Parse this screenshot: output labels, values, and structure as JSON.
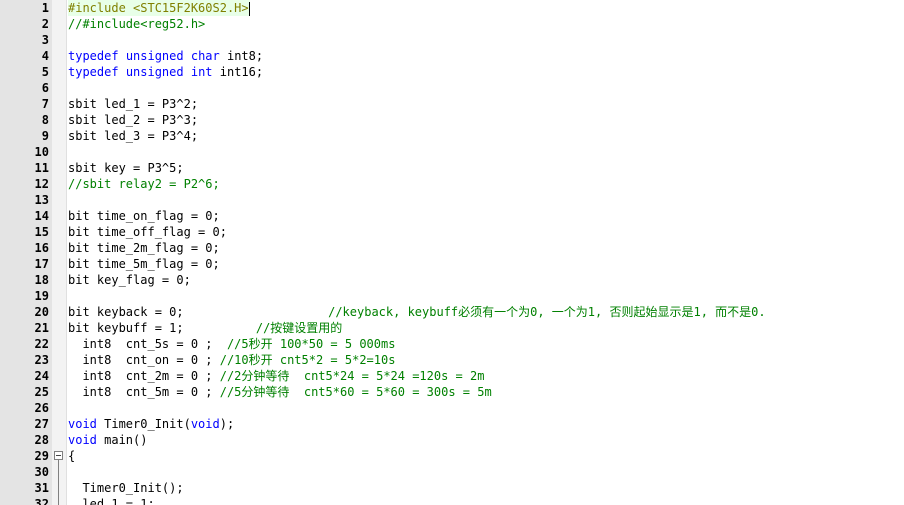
{
  "editor": {
    "current_line": 1,
    "lines": [
      {
        "n": "1",
        "tokens": [
          {
            "t": "#include <STC15F2K60S2.H>",
            "c": "pp"
          }
        ]
      },
      {
        "n": "2",
        "tokens": [
          {
            "t": "//#include<reg52.h>",
            "c": "cm"
          }
        ]
      },
      {
        "n": "3",
        "tokens": []
      },
      {
        "n": "4",
        "tokens": [
          {
            "t": "typedef",
            "c": "kw"
          },
          {
            "t": " "
          },
          {
            "t": "unsigned",
            "c": "kw"
          },
          {
            "t": " "
          },
          {
            "t": "char",
            "c": "kw"
          },
          {
            "t": " int8;"
          }
        ]
      },
      {
        "n": "5",
        "tokens": [
          {
            "t": "typedef",
            "c": "kw"
          },
          {
            "t": " "
          },
          {
            "t": "unsigned",
            "c": "kw"
          },
          {
            "t": " "
          },
          {
            "t": "int",
            "c": "kw"
          },
          {
            "t": " int16;"
          }
        ]
      },
      {
        "n": "6",
        "tokens": []
      },
      {
        "n": "7",
        "tokens": [
          {
            "t": "sbit led_1 = P3^2;"
          }
        ]
      },
      {
        "n": "8",
        "tokens": [
          {
            "t": "sbit led_2 = P3^3;"
          }
        ]
      },
      {
        "n": "9",
        "tokens": [
          {
            "t": "sbit led_3 = P3^4;"
          }
        ]
      },
      {
        "n": "10",
        "tokens": []
      },
      {
        "n": "11",
        "tokens": [
          {
            "t": "sbit key = P3^5;"
          }
        ]
      },
      {
        "n": "12",
        "tokens": [
          {
            "t": "//sbit relay2 = P2^6;",
            "c": "cm"
          }
        ]
      },
      {
        "n": "13",
        "tokens": []
      },
      {
        "n": "14",
        "tokens": [
          {
            "t": "bit time_on_flag = 0;"
          }
        ]
      },
      {
        "n": "15",
        "tokens": [
          {
            "t": "bit time_off_flag = 0;"
          }
        ]
      },
      {
        "n": "16",
        "tokens": [
          {
            "t": "bit time_2m_flag = 0;"
          }
        ]
      },
      {
        "n": "17",
        "tokens": [
          {
            "t": "bit time_5m_flag = 0;"
          }
        ]
      },
      {
        "n": "18",
        "tokens": [
          {
            "t": "bit key_flag = 0;"
          }
        ]
      },
      {
        "n": "19",
        "tokens": []
      },
      {
        "n": "20",
        "tokens": [
          {
            "t": "bit keyback = 0;                    "
          },
          {
            "t": "//keyback, keybuff必须有一个为0, 一个为1, 否则起始显示是1, 而不是0.",
            "c": "cm"
          }
        ]
      },
      {
        "n": "21",
        "tokens": [
          {
            "t": "bit keybuff = 1;          "
          },
          {
            "t": "//按键设置用的",
            "c": "cm"
          }
        ]
      },
      {
        "n": "22",
        "tokens": [
          {
            "t": "  int8  cnt_5s = 0 ;  "
          },
          {
            "t": "//5秒开 100*50 = 5 000ms",
            "c": "cm"
          }
        ]
      },
      {
        "n": "23",
        "tokens": [
          {
            "t": "  int8  cnt_on = 0 ; "
          },
          {
            "t": "//10秒开 cnt5*2 = 5*2=10s",
            "c": "cm"
          }
        ]
      },
      {
        "n": "24",
        "tokens": [
          {
            "t": "  int8  cnt_2m = 0 ; "
          },
          {
            "t": "//2分钟等待  cnt5*24 = 5*24 =120s = 2m",
            "c": "cm"
          }
        ]
      },
      {
        "n": "25",
        "tokens": [
          {
            "t": "  int8  cnt_5m = 0 ; "
          },
          {
            "t": "//5分钟等待  cnt5*60 = 5*60 = 300s = 5m",
            "c": "cm"
          }
        ]
      },
      {
        "n": "26",
        "tokens": []
      },
      {
        "n": "27",
        "tokens": [
          {
            "t": "void",
            "c": "kw"
          },
          {
            "t": " Timer0_Init("
          },
          {
            "t": "void",
            "c": "kw"
          },
          {
            "t": ");"
          }
        ]
      },
      {
        "n": "28",
        "tokens": [
          {
            "t": "void",
            "c": "kw"
          },
          {
            "t": " main()"
          }
        ]
      },
      {
        "n": "29",
        "tokens": [
          {
            "t": "{"
          }
        ],
        "fold": true
      },
      {
        "n": "30",
        "tokens": []
      },
      {
        "n": "31",
        "tokens": [
          {
            "t": "  Timer0_Init();"
          }
        ]
      },
      {
        "n": "32",
        "tokens": [
          {
            "t": "  led_1 = 1;"
          }
        ]
      }
    ]
  }
}
